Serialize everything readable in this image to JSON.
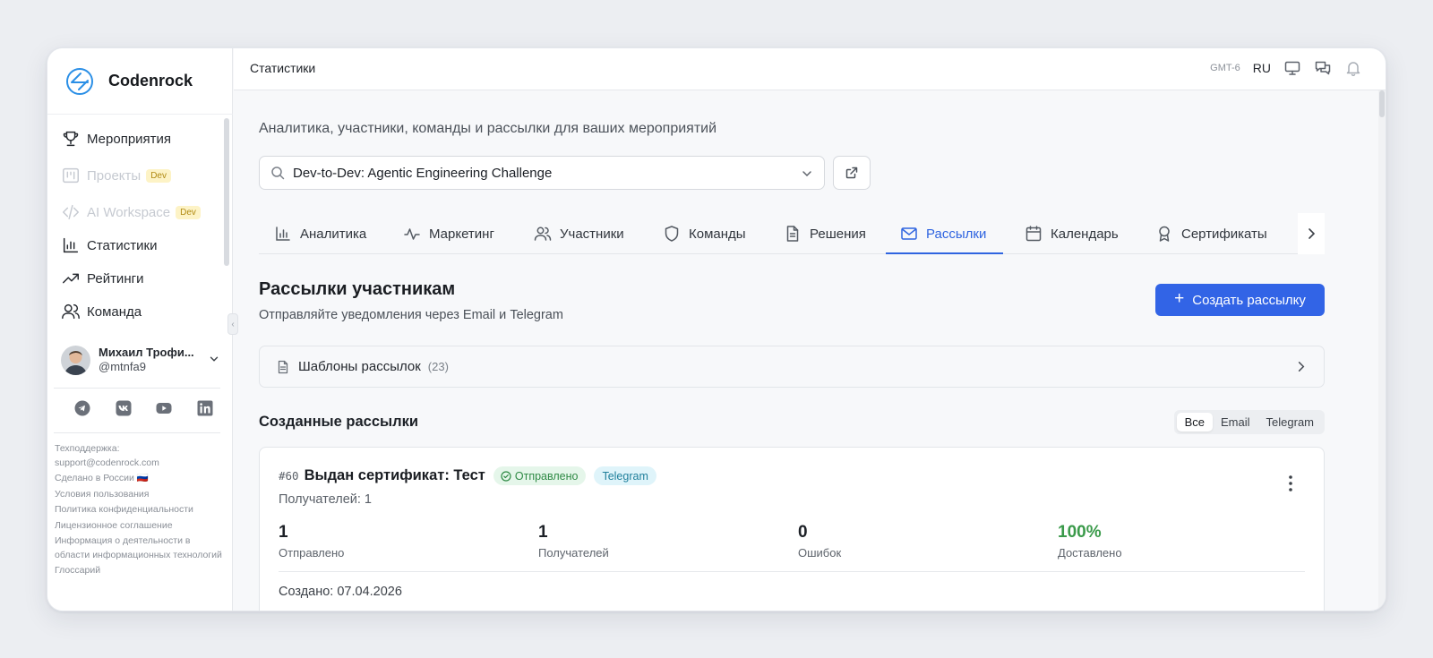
{
  "app": {
    "name": "Codenrock"
  },
  "sidebar": {
    "items": [
      {
        "label": "Мероприятия",
        "icon": "trophy-icon",
        "disabled": false
      },
      {
        "label": "Проекты",
        "icon": "kanban-icon",
        "disabled": true,
        "badge": "Dev"
      },
      {
        "label": "AI Workspace",
        "icon": "code-icon",
        "disabled": true,
        "badge": "Dev"
      },
      {
        "label": "Статистики",
        "icon": "bar-chart-icon",
        "disabled": false
      },
      {
        "label": "Рейтинги",
        "icon": "trending-up-icon",
        "disabled": false
      },
      {
        "label": "Команда",
        "icon": "users-icon",
        "disabled": false
      }
    ],
    "user": {
      "name": "Михаил Трофи...",
      "handle": "@mtnfa9"
    },
    "socials": [
      "telegram-icon",
      "vk-icon",
      "youtube-icon",
      "linkedin-icon"
    ],
    "footer": {
      "support_label": "Техподдержка:",
      "support_email": "support@codenrock.com",
      "made_in": "Сделано в России 🇷🇺",
      "terms": "Условия пользования",
      "privacy": "Политика конфиденциальности",
      "license": "Лицензионное соглашение",
      "it_info": "Информация о деятельности в области информационных технологий",
      "glossary": "Глоссарий"
    }
  },
  "topbar": {
    "title": "Статистики",
    "timezone": "GMT-6",
    "language": "RU"
  },
  "main": {
    "subtitle": "Аналитика, участники, команды и рассылки для ваших мероприятий",
    "event_select": {
      "value": "Dev-to-Dev: Agentic Engineering Challenge"
    },
    "tabs": [
      {
        "label": "Аналитика",
        "icon": "bar-chart-icon"
      },
      {
        "label": "Маркетинг",
        "icon": "activity-icon"
      },
      {
        "label": "Участники",
        "icon": "users-icon"
      },
      {
        "label": "Команды",
        "icon": "shield-icon"
      },
      {
        "label": "Решения",
        "icon": "file-text-icon"
      },
      {
        "label": "Рассылки",
        "icon": "mail-icon",
        "active": true
      },
      {
        "label": "Календарь",
        "icon": "calendar-icon"
      },
      {
        "label": "Сертификаты",
        "icon": "award-icon"
      }
    ],
    "section": {
      "title": "Рассылки участникам",
      "description": "Отправляйте уведомления через Email и Telegram",
      "create_button": "Создать рассылку"
    },
    "templates": {
      "label": "Шаблоны рассылок",
      "count": "(23)"
    },
    "created": {
      "title": "Созданные рассылки",
      "filters": [
        {
          "label": "Все",
          "active": true
        },
        {
          "label": "Email",
          "active": false
        },
        {
          "label": "Telegram",
          "active": false
        }
      ]
    },
    "mailing": {
      "number": "#60",
      "title": "Выдан сертификат: Тест",
      "status": "Отправлено",
      "channel": "Telegram",
      "recipients": "Получателей: 1",
      "stats": [
        {
          "value": "1",
          "label": "Отправлено"
        },
        {
          "value": "1",
          "label": "Получателей"
        },
        {
          "value": "0",
          "label": "Ошибок"
        },
        {
          "value": "100%",
          "label": "Доставлено"
        }
      ],
      "created_at": "Создано: 07.04.2026"
    }
  },
  "colors": {
    "accent": "#3264e6",
    "success": "#3a9a4a",
    "brand_logo": "#2b8fe6"
  }
}
